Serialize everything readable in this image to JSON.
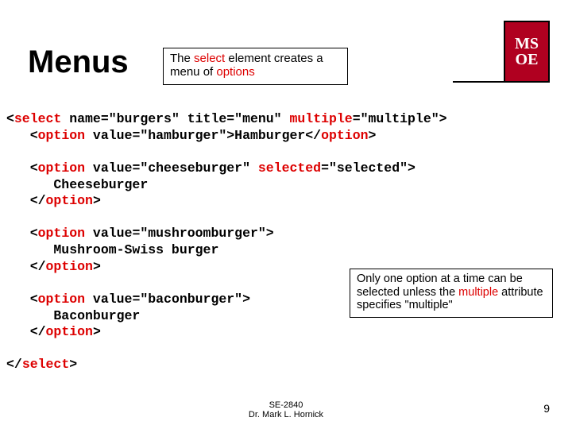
{
  "title": "Menus",
  "callout1": {
    "pre": "The ",
    "kw1": "select",
    "mid": " element creates a menu of ",
    "kw2": "options"
  },
  "logo": {
    "line1": "MS",
    "line2": "OE"
  },
  "code": {
    "l1a": "<",
    "l1b": "select",
    "l1c": " name=\"burgers\" title=\"menu\" ",
    "l1d": "multiple",
    "l1e": "=\"multiple\">",
    "l2a": "   <",
    "l2b": "option",
    "l2c": " value=\"hamburger\">Hamburger</",
    "l2d": "option",
    "l2e": ">",
    "l3a": "   <",
    "l3b": "option",
    "l3c": " value=\"cheeseburger\" ",
    "l3d": "selected",
    "l3e": "=\"selected\">",
    "l4": "      Cheeseburger",
    "l5a": "   </",
    "l5b": "option",
    "l5c": ">",
    "l6a": "   <",
    "l6b": "option",
    "l6c": " value=\"mushroomburger\">",
    "l7": "      Mushroom-Swiss burger",
    "l8a": "   </",
    "l8b": "option",
    "l8c": ">",
    "l9a": "   <",
    "l9b": "option",
    "l9c": " value=\"baconburger\">",
    "l10": "      Baconburger",
    "l11a": "   </",
    "l11b": "option",
    "l11c": ">",
    "l12a": "</",
    "l12b": "select",
    "l12c": ">"
  },
  "callout2": {
    "pre": "Only one option at a time can be selected unless the ",
    "kw": "multiple",
    "post": " attribute specifies \"multiple\""
  },
  "footer": {
    "line1": "SE-2840",
    "line2": "Dr. Mark L. Hornick"
  },
  "pagenum": "9"
}
